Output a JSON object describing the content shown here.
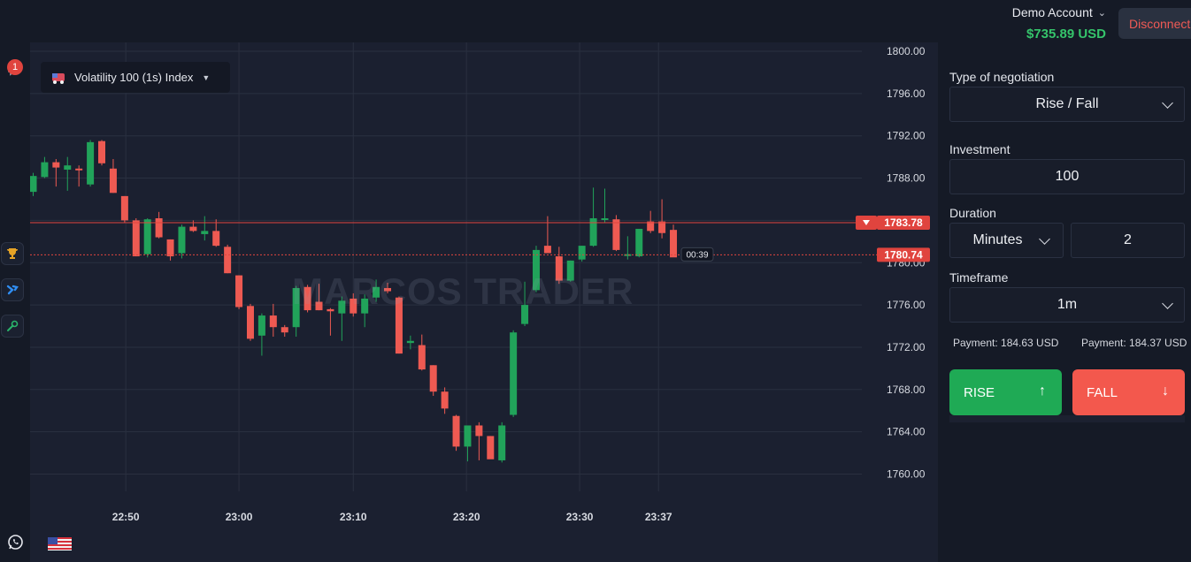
{
  "header": {
    "account_name": "Demo Account",
    "account_balance": "$735.89 USD",
    "disconnect_label": "Disconnect"
  },
  "notifications": {
    "count": "1"
  },
  "chart": {
    "symbol": "Volatility 100 (1s) Index",
    "watermark": "MARCOS TRADER",
    "current_price": "1783.78",
    "entry_price": "1780.74",
    "countdown": "00:39",
    "colors": {
      "up": "#21a35a",
      "down": "#ee5a52",
      "grid": "#2a3040",
      "price_line": "#e0443e"
    }
  },
  "chart_data": {
    "type": "candlestick",
    "title": "",
    "xlabel": "",
    "ylabel": "",
    "ylim": [
      1758.0,
      1800.0
    ],
    "y_ticks": [
      "1800.00",
      "1796.00",
      "1792.00",
      "1788.00",
      "1784.00",
      "1780.00",
      "1776.00",
      "1772.00",
      "1768.00",
      "1764.00",
      "1760.00"
    ],
    "x_ticks": [
      {
        "label": "22:50",
        "t": 8.1
      },
      {
        "label": "23:00",
        "t": 18.0
      },
      {
        "label": "23:10",
        "t": 28.0
      },
      {
        "label": "23:20",
        "t": 37.9
      },
      {
        "label": "23:30",
        "t": 47.8
      },
      {
        "label": "23:37",
        "t": 54.7
      }
    ],
    "candles": [
      {
        "o": 1786.7,
        "h": 1788.5,
        "l": 1786.3,
        "c": 1788.2
      },
      {
        "o": 1788.1,
        "h": 1790.0,
        "l": 1788.0,
        "c": 1789.5
      },
      {
        "o": 1789.5,
        "h": 1789.8,
        "l": 1787.2,
        "c": 1789.0
      },
      {
        "o": 1788.8,
        "h": 1790.0,
        "l": 1786.8,
        "c": 1789.2
      },
      {
        "o": 1788.9,
        "h": 1789.2,
        "l": 1787.2,
        "c": 1788.8
      },
      {
        "o": 1787.4,
        "h": 1791.6,
        "l": 1787.2,
        "c": 1791.4
      },
      {
        "o": 1791.5,
        "h": 1791.6,
        "l": 1789.2,
        "c": 1789.4
      },
      {
        "o": 1788.9,
        "h": 1789.8,
        "l": 1786.6,
        "c": 1786.6
      },
      {
        "o": 1786.3,
        "h": 1786.3,
        "l": 1783.8,
        "c": 1784.0
      },
      {
        "o": 1784.0,
        "h": 1784.2,
        "l": 1780.6,
        "c": 1780.6
      },
      {
        "o": 1780.8,
        "h": 1784.2,
        "l": 1780.5,
        "c": 1784.1
      },
      {
        "o": 1784.2,
        "h": 1784.8,
        "l": 1782.3,
        "c": 1782.4
      },
      {
        "o": 1782.2,
        "h": 1782.2,
        "l": 1780.2,
        "c": 1780.6
      },
      {
        "o": 1780.9,
        "h": 1783.6,
        "l": 1780.4,
        "c": 1783.4
      },
      {
        "o": 1783.4,
        "h": 1784.0,
        "l": 1782.9,
        "c": 1783.0
      },
      {
        "o": 1782.7,
        "h": 1784.4,
        "l": 1782.1,
        "c": 1783.0
      },
      {
        "o": 1783.0,
        "h": 1784.1,
        "l": 1781.5,
        "c": 1781.6
      },
      {
        "o": 1781.5,
        "h": 1781.7,
        "l": 1779.0,
        "c": 1779.0
      },
      {
        "o": 1778.8,
        "h": 1778.8,
        "l": 1775.6,
        "c": 1775.8
      },
      {
        "o": 1775.9,
        "h": 1776.1,
        "l": 1772.6,
        "c": 1772.8
      },
      {
        "o": 1773.1,
        "h": 1775.2,
        "l": 1771.2,
        "c": 1775.0
      },
      {
        "o": 1775.0,
        "h": 1776.1,
        "l": 1773.0,
        "c": 1773.9
      },
      {
        "o": 1773.9,
        "h": 1774.1,
        "l": 1773.0,
        "c": 1773.4
      },
      {
        "o": 1773.9,
        "h": 1777.8,
        "l": 1773.0,
        "c": 1777.6
      },
      {
        "o": 1777.7,
        "h": 1777.9,
        "l": 1775.3,
        "c": 1775.5
      },
      {
        "o": 1776.3,
        "h": 1778.0,
        "l": 1775.5,
        "c": 1775.5
      },
      {
        "o": 1775.6,
        "h": 1775.7,
        "l": 1773.1,
        "c": 1775.4
      },
      {
        "o": 1775.2,
        "h": 1776.8,
        "l": 1772.6,
        "c": 1776.4
      },
      {
        "o": 1776.6,
        "h": 1777.1,
        "l": 1774.9,
        "c": 1775.2
      },
      {
        "o": 1775.2,
        "h": 1777.0,
        "l": 1773.9,
        "c": 1776.6
      },
      {
        "o": 1776.7,
        "h": 1778.4,
        "l": 1776.3,
        "c": 1777.7
      },
      {
        "o": 1777.6,
        "h": 1778.1,
        "l": 1777.1,
        "c": 1777.3
      },
      {
        "o": 1776.7,
        "h": 1776.8,
        "l": 1771.4,
        "c": 1771.4
      },
      {
        "o": 1772.4,
        "h": 1773.1,
        "l": 1771.8,
        "c": 1772.6
      },
      {
        "o": 1772.2,
        "h": 1773.2,
        "l": 1769.8,
        "c": 1769.9
      },
      {
        "o": 1770.3,
        "h": 1770.3,
        "l": 1767.4,
        "c": 1767.8
      },
      {
        "o": 1767.8,
        "h": 1768.2,
        "l": 1765.7,
        "c": 1766.2
      },
      {
        "o": 1765.5,
        "h": 1765.6,
        "l": 1762.2,
        "c": 1762.6
      },
      {
        "o": 1762.6,
        "h": 1763.8,
        "l": 1761.2,
        "c": 1764.6
      },
      {
        "o": 1764.6,
        "h": 1764.9,
        "l": 1761.3,
        "c": 1763.6
      },
      {
        "o": 1763.6,
        "h": 1763.6,
        "l": 1761.6,
        "c": 1761.4
      },
      {
        "o": 1761.3,
        "h": 1764.9,
        "l": 1761.1,
        "c": 1764.6
      },
      {
        "o": 1765.6,
        "h": 1773.6,
        "l": 1765.4,
        "c": 1773.4
      },
      {
        "o": 1774.2,
        "h": 1778.2,
        "l": 1774.0,
        "c": 1776.0
      },
      {
        "o": 1777.4,
        "h": 1781.6,
        "l": 1777.2,
        "c": 1781.2
      },
      {
        "o": 1781.6,
        "h": 1784.4,
        "l": 1781.1,
        "c": 1780.9
      },
      {
        "o": 1780.6,
        "h": 1781.5,
        "l": 1778.0,
        "c": 1778.3
      },
      {
        "o": 1778.3,
        "h": 1780.2,
        "l": 1778.2,
        "c": 1780.2
      },
      {
        "o": 1780.3,
        "h": 1781.6,
        "l": 1780.1,
        "c": 1781.6
      },
      {
        "o": 1781.6,
        "h": 1787.1,
        "l": 1781.5,
        "c": 1784.2
      },
      {
        "o": 1784.1,
        "h": 1787.0,
        "l": 1783.8,
        "c": 1784.2
      },
      {
        "o": 1784.1,
        "h": 1784.5,
        "l": 1781.1,
        "c": 1781.2
      },
      {
        "o": 1780.8,
        "h": 1782.5,
        "l": 1780.3,
        "c": 1780.8
      },
      {
        "o": 1780.6,
        "h": 1783.0,
        "l": 1780.5,
        "c": 1783.2
      },
      {
        "o": 1783.9,
        "h": 1784.9,
        "l": 1782.8,
        "c": 1783.0
      },
      {
        "o": 1783.9,
        "h": 1786.0,
        "l": 1782.3,
        "c": 1782.8
      },
      {
        "o": 1783.1,
        "h": 1783.6,
        "l": 1780.7,
        "c": 1780.5
      }
    ]
  },
  "panel": {
    "negotiation_label": "Type of negotiation",
    "negotiation_value": "Rise / Fall",
    "investment_label": "Investment",
    "investment_value": "100",
    "duration_label": "Duration",
    "duration_unit": "Minutes",
    "duration_value": "2",
    "timeframe_label": "Timeframe",
    "timeframe_value": "1m",
    "payment_rise": "Payment: 184.63 USD",
    "payment_fall": "Payment: 184.37 USD",
    "rise_label": "RISE",
    "fall_label": "FALL",
    "rise_color": "#1faa55",
    "fall_color": "#f3584d"
  },
  "footer": {
    "country_flag": "us-flag-icon"
  }
}
